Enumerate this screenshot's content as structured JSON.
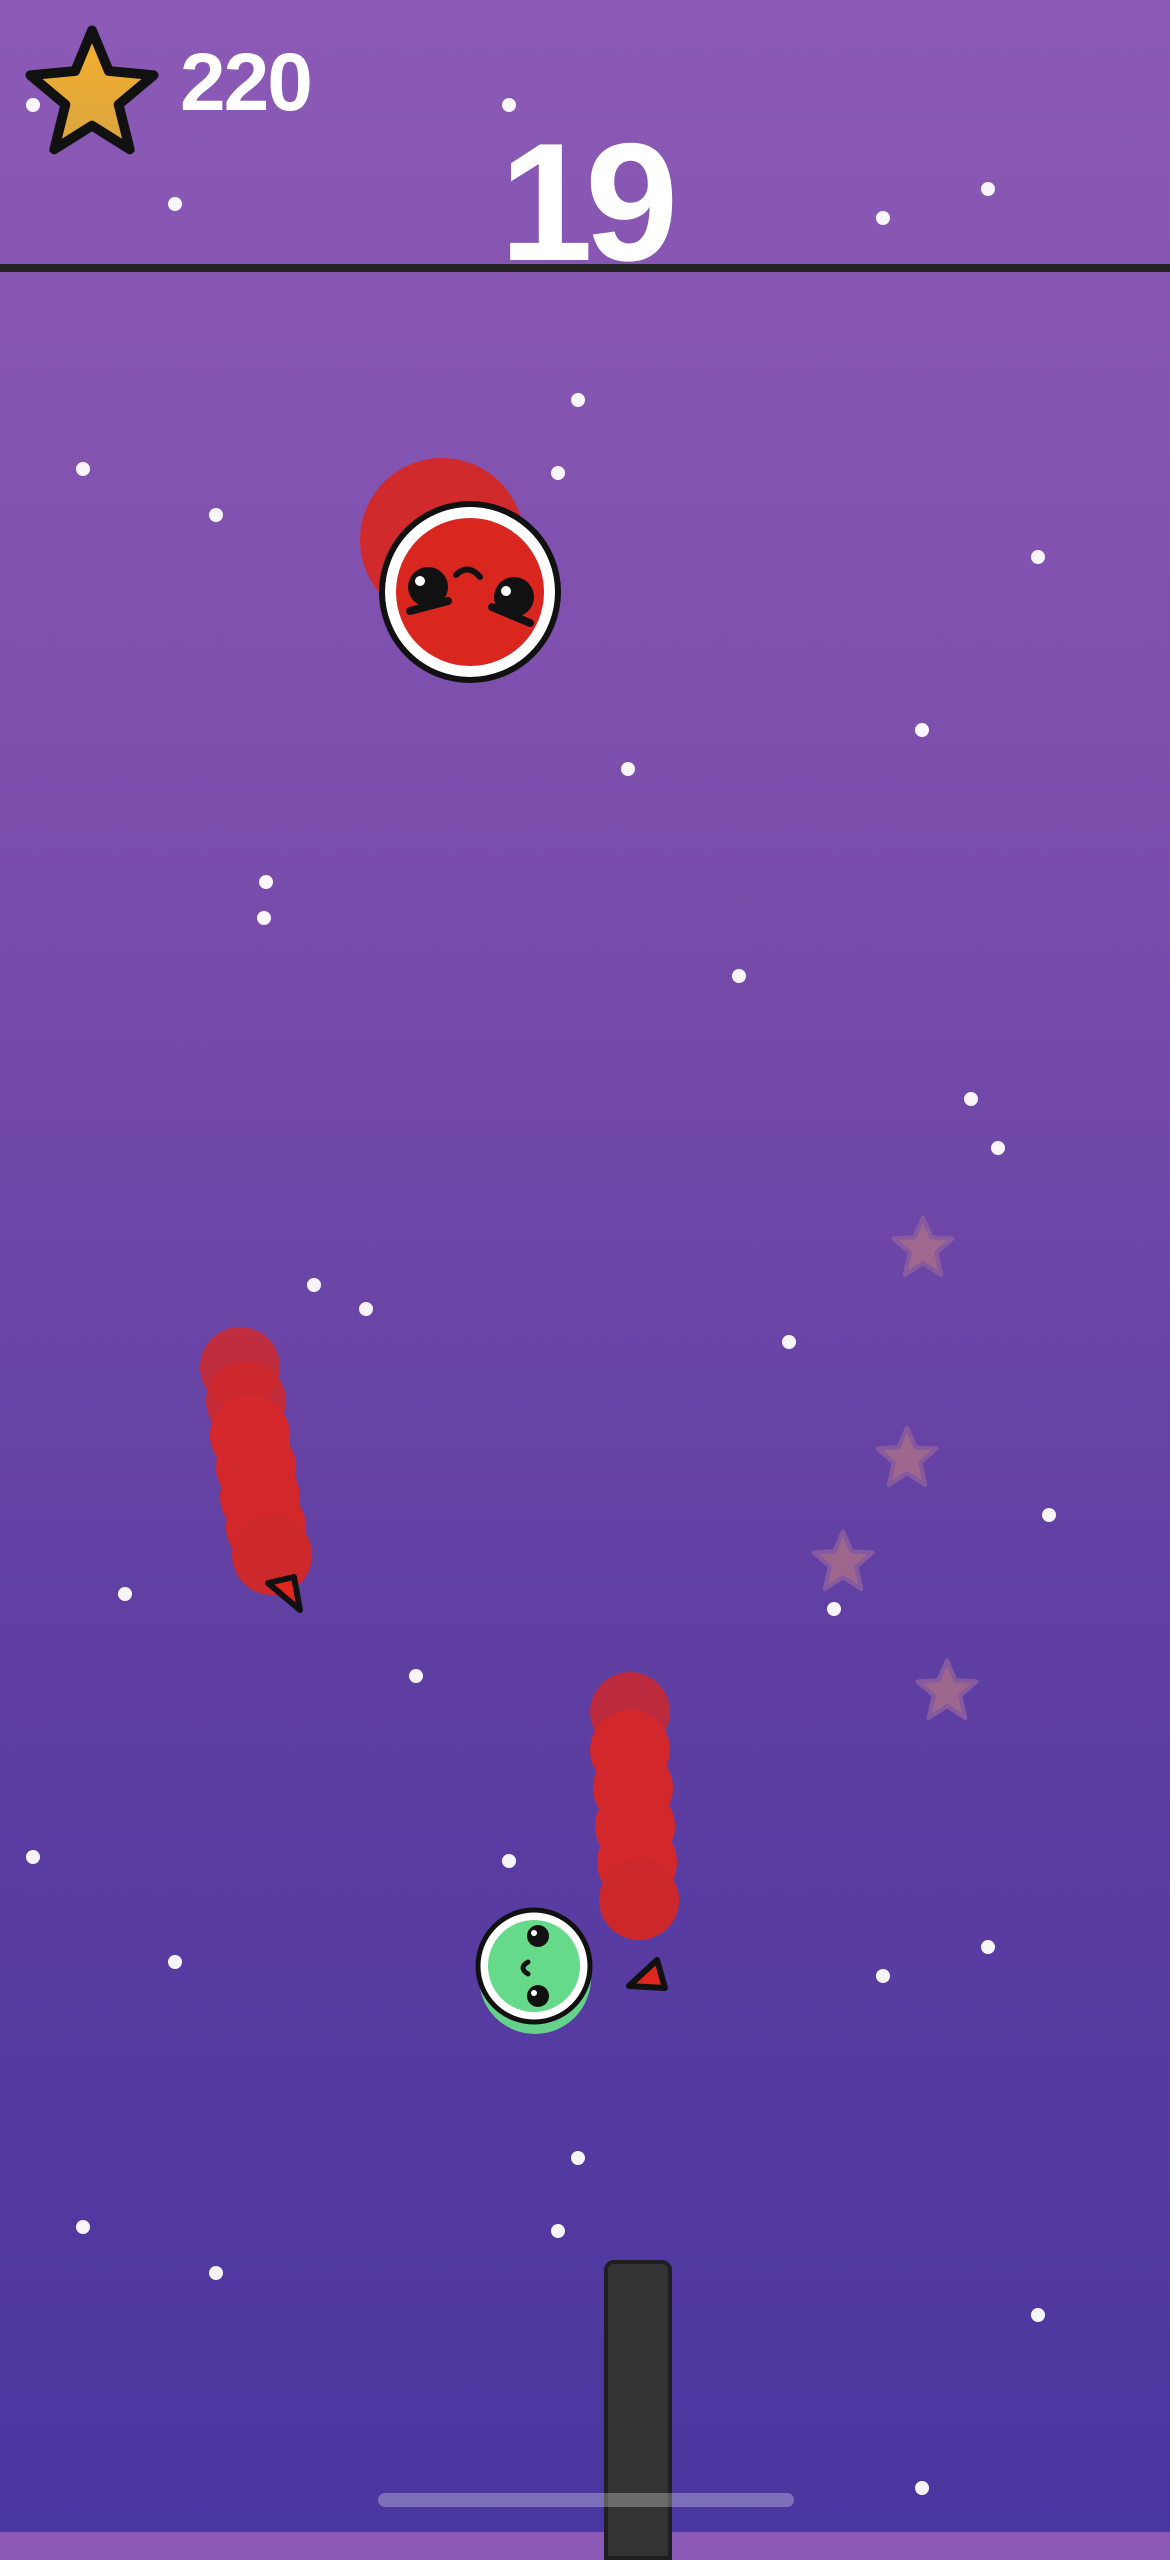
{
  "hud": {
    "coins": "220",
    "level": "19",
    "coin_icon": "star-icon"
  },
  "colors": {
    "background_top": "#8c5ab6",
    "background_bottom": "#4a36a0",
    "enemy_red": "#d9261f",
    "player_green": "#66d98a",
    "star_gold": "#f0a32a",
    "ceiling_line": "#222222",
    "pillar": "#333333"
  },
  "entities": {
    "boss": "red-face-ball",
    "player": "green-face-ball",
    "enemies": [
      "red-worm",
      "red-worm"
    ],
    "pickups": [
      "faded-star",
      "faded-star",
      "faded-star",
      "faded-star"
    ]
  }
}
